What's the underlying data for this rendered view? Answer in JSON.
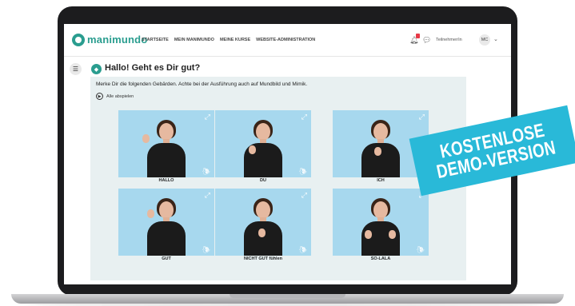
{
  "app": {
    "logo_text": "manimundo",
    "nav_items": [
      "STARTSEITE",
      "MEIN MANIMUNDO",
      "MEINE KURSE",
      "WEBSITE-ADMINISTRATION"
    ],
    "user_role": "Teilnehmer/in",
    "user_initials": "MC",
    "icons": [
      "bell-icon",
      "chat-icon",
      "chevron-down-icon",
      "menu-icon"
    ]
  },
  "page": {
    "title": "Hallo! Geht es Dir gut?",
    "instruction": "Merke Dir die folgenden Gebärden. Achte bei der Ausführung auch auf Mundbild und Mimik.",
    "play_all_label": "Alle abspielen"
  },
  "cards": [
    {
      "caption": "HALLO"
    },
    {
      "caption": "DU"
    },
    {
      "caption": "ICH"
    },
    {
      "caption": "GUT"
    },
    {
      "caption": "NICHT GUT fühlen"
    },
    {
      "caption": "SO-LALA"
    }
  ],
  "banner": {
    "line1": "KOSTENLOSE",
    "line2": "DEMO-VERSION"
  },
  "colors": {
    "brand": "#2a9d8f",
    "video_bg": "#a7d8ee",
    "panel_bg": "#e8f0f1",
    "banner_bg": "#29b9d8",
    "notification": "#e63946"
  }
}
